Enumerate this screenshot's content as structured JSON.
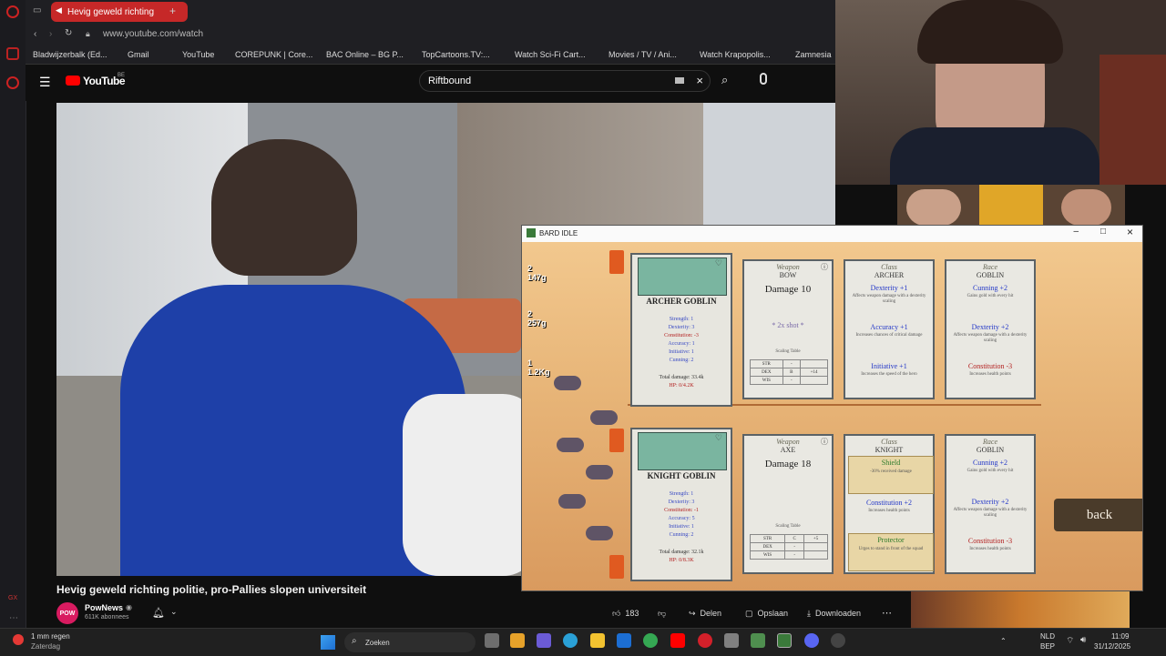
{
  "browser": {
    "tab_title": "Hevig geweld richting",
    "url": "www.youtube.com/watch",
    "bookmarks": [
      "Bladwijzerbalk (Ed...",
      "Gmail",
      "YouTube",
      "COREPUNK | Core...",
      "BAC Online – BG P...",
      "TopCartoons.TV:...",
      "Watch Sci-Fi Cart...",
      "Movies / TV / Ani...",
      "Watch Krapopolis...",
      "Zamnesia"
    ]
  },
  "youtube": {
    "logo_text": "YouTube",
    "region": "BE",
    "search_value": "Riftbound",
    "video_title": "Hevig geweld richting politie, pro-Pallies slopen universiteit",
    "channel_name": "PowNews",
    "channel_avatar": "POW",
    "subscribers": "611K abonnees",
    "likes": "183",
    "share_label": "Delen",
    "save_label": "Opslaan",
    "download_label": "Downloaden"
  },
  "game": {
    "window_title": "BARD IDLE",
    "resources": [
      {
        "count": "2",
        "amount": "147g",
        "color": "#e0b020"
      },
      {
        "count": "2",
        "amount": "257g",
        "color": "#3fae3f"
      },
      {
        "count": "1",
        "amount": "1.2Kg",
        "color": "#3a6fd8"
      }
    ],
    "units": [
      {
        "name": "ARCHER GOBLIN",
        "stats": [
          "Strength: 1",
          "Dexterity: 3",
          "Constitution: -3",
          "Accuracy: 1",
          "Initiative: 1",
          "Cunning: 2"
        ],
        "total_damage": "Total damage: 33.4k",
        "hp": "HP: 0/4.2K",
        "weapon": {
          "caption": "Weapon",
          "name": "BOW",
          "damage": "Damage 10",
          "note": "* 2x shot *",
          "scaling_label": "Scaling Table",
          "scaling": [
            [
              "STR",
              "-",
              ""
            ],
            [
              "DEX",
              "B",
              "+14"
            ],
            [
              "WIS",
              "-",
              ""
            ]
          ]
        },
        "class": {
          "caption": "Class",
          "name": "ARCHER",
          "traits": [
            {
              "title": "Dexterity +1",
              "desc": "Affects weapon damage with a dexterity scaling",
              "color": "blue"
            },
            {
              "title": "Accuracy +1",
              "desc": "Increases chances of critical damage",
              "color": "blue"
            },
            {
              "title": "Initiative +1",
              "desc": "Increases the speed of the hero",
              "color": "blue"
            }
          ]
        },
        "race": {
          "caption": "Race",
          "name": "GOBLIN",
          "traits": [
            {
              "title": "Cunning +2",
              "desc": "Gains gold with every hit",
              "color": "blue"
            },
            {
              "title": "Dexterity +2",
              "desc": "Affects weapon damage with a dexterity scaling",
              "color": "blue"
            },
            {
              "title": "Constitution -3",
              "desc": "Increases health points",
              "color": "red"
            }
          ]
        }
      },
      {
        "name": "KNIGHT GOBLIN",
        "stats": [
          "Strength: 1",
          "Dexterity: 3",
          "Constitution: -1",
          "Accuracy: 5",
          "Initiative: 1",
          "Cunning: 2"
        ],
        "total_damage": "Total damage: 32.1k",
        "hp": "HP: 0/8.3K",
        "weapon": {
          "caption": "Weapon",
          "name": "AXE",
          "damage": "Damage 18",
          "note": "",
          "scaling_label": "Scaling Table",
          "scaling": [
            [
              "STR",
              "C",
              "+5"
            ],
            [
              "DEX",
              "-",
              ""
            ],
            [
              "WIS",
              "-",
              ""
            ]
          ]
        },
        "class": {
          "caption": "Class",
          "name": "KNIGHT",
          "traits": [
            {
              "title": "Shield",
              "desc": "-30% received damage",
              "color": "dark"
            },
            {
              "title": "Constitution +2",
              "desc": "Increases health points",
              "color": "blue"
            },
            {
              "title": "Protector",
              "desc": "Urges to stand in front of the squad",
              "color": "dark"
            }
          ]
        },
        "race": {
          "caption": "Race",
          "name": "GOBLIN",
          "traits": [
            {
              "title": "Cunning +2",
              "desc": "Gains gold with every hit",
              "color": "blue"
            },
            {
              "title": "Dexterity +2",
              "desc": "Affects weapon damage with a dexterity scaling",
              "color": "blue"
            },
            {
              "title": "Constitution -3",
              "desc": "Increases health points",
              "color": "red"
            }
          ]
        }
      }
    ],
    "back_label": "back"
  },
  "taskbar": {
    "weather_title": "1 mm regen",
    "weather_sub": "Zaterdag",
    "search_label": "Zoeken",
    "lang": "NLD",
    "lang2": "BEP",
    "time": "11:09",
    "date": "31/12/2025"
  }
}
